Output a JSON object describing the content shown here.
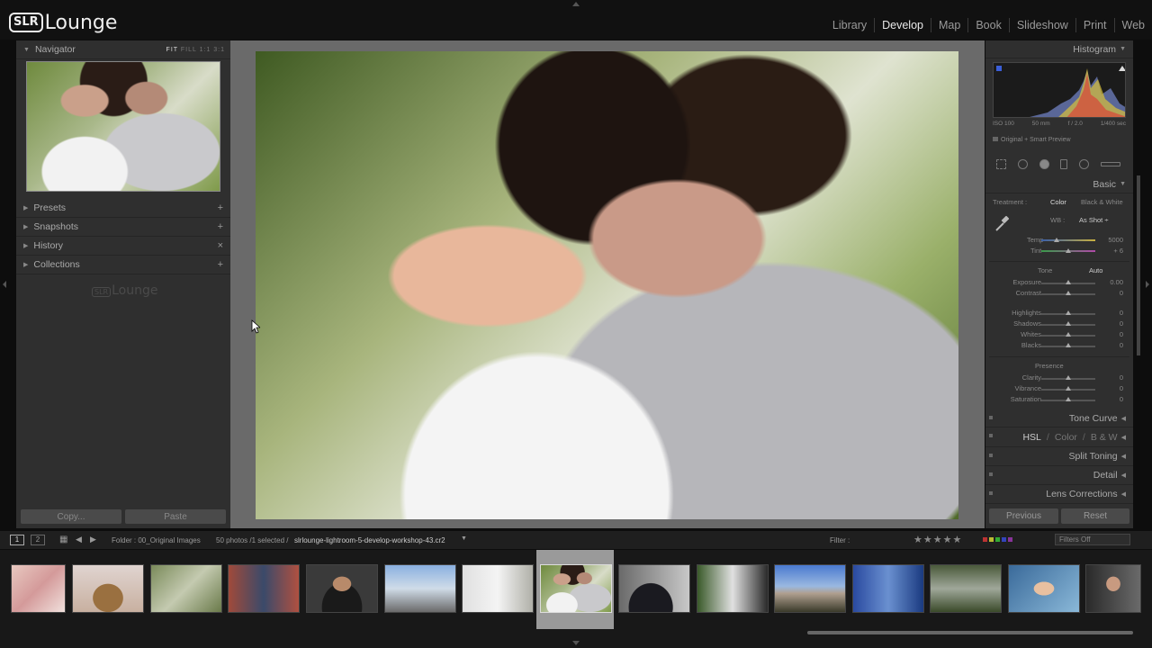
{
  "app": {
    "logo_badge": "SLR",
    "logo_text": "Lounge"
  },
  "modules": [
    {
      "label": "Library",
      "active": false
    },
    {
      "label": "Develop",
      "active": true
    },
    {
      "label": "Map",
      "active": false
    },
    {
      "label": "Book",
      "active": false
    },
    {
      "label": "Slideshow",
      "active": false
    },
    {
      "label": "Print",
      "active": false
    },
    {
      "label": "Web",
      "active": false
    }
  ],
  "left": {
    "navigator_title": "Navigator",
    "nav_modes": [
      "FIT",
      "FILL",
      "1:1",
      "3:1"
    ],
    "sections": [
      {
        "label": "Presets",
        "action": "+"
      },
      {
        "label": "Snapshots",
        "action": "+"
      },
      {
        "label": "History",
        "action": "×"
      },
      {
        "label": "Collections",
        "action": "+"
      }
    ],
    "watermark_badge": "SLR",
    "watermark_text": "Lounge",
    "copy_label": "Copy...",
    "paste_label": "Paste"
  },
  "right": {
    "histogram_title": "Histogram",
    "hist_info": [
      "ISO 100",
      "50 mm",
      "f / 2.0",
      "1/400 sec"
    ],
    "hist_sub": "Original + Smart Preview",
    "basic_title": "Basic",
    "treatment_label": "Treatment :",
    "treatment_color": "Color",
    "treatment_bw": "Black & White",
    "wb_label": "WB :",
    "wb_value": "As Shot ÷",
    "temp_label": "Temp",
    "temp_value": "5000",
    "tint_label": "Tint",
    "tint_value": "+ 6",
    "tone_label": "Tone",
    "tone_auto": "Auto",
    "tone_sliders": [
      {
        "label": "Exposure",
        "value": "0.00"
      },
      {
        "label": "Contrast",
        "value": "0"
      }
    ],
    "light_sliders": [
      {
        "label": "Highlights",
        "value": "0"
      },
      {
        "label": "Shadows",
        "value": "0"
      },
      {
        "label": "Whites",
        "value": "0"
      },
      {
        "label": "Blacks",
        "value": "0"
      }
    ],
    "presence_label": "Presence",
    "presence_sliders": [
      {
        "label": "Clarity",
        "value": "0"
      },
      {
        "label": "Vibrance",
        "value": "0"
      },
      {
        "label": "Saturation",
        "value": "0"
      }
    ],
    "tone_curve": "Tone Curve",
    "hsl": "HSL",
    "hsl_sep1": "/",
    "hsl_color": "Color",
    "hsl_sep2": "/",
    "hsl_bw": "B & W",
    "split_toning": "Split Toning",
    "detail": "Detail",
    "lens_corrections": "Lens Corrections",
    "previous_label": "Previous",
    "reset_label": "Reset"
  },
  "filmbar": {
    "view1": "1",
    "view2": "2",
    "folder": "Folder : 00_Original Images",
    "count": "50 photos /1 selected /",
    "filename": "slrlounge-lightroom-5-develop-workshop-43.cr2",
    "filter_label": "Filter :",
    "filters_off": "Filters Off"
  },
  "colors": {
    "accent_selected_cell": "#9a9a9a",
    "panel_bg": "#2f2f2f",
    "center_bg": "#6a6a6a"
  }
}
